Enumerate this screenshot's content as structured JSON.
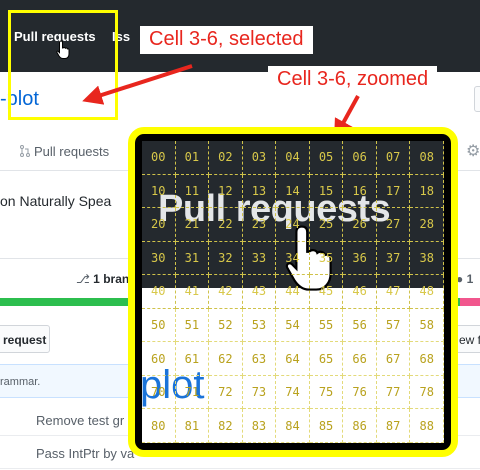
{
  "nav": {
    "pull_requests": "Pull requests",
    "issues": "Issues"
  },
  "repo": {
    "title": "-plot"
  },
  "tabs": {
    "pull_requests": "Pull requests"
  },
  "description": "on Naturally Spea",
  "stats": {
    "branches_count": "1",
    "branches_label": "bran",
    "contributors_count": "1"
  },
  "buttons": {
    "request": "request",
    "new_file": "ew f"
  },
  "commit": {
    "message": "rammar."
  },
  "files": [
    {
      "message": "Remove test gr"
    },
    {
      "message": "Pass IntPtr by va"
    }
  ],
  "annotations": {
    "selected_label": "Cell 3-6, selected",
    "zoomed_label": "Cell 3-6, zoomed"
  },
  "zoom": {
    "text": "Pull requests",
    "repo_text": "plot",
    "cells": [
      "00",
      "01",
      "02",
      "03",
      "04",
      "05",
      "06",
      "07",
      "08",
      "10",
      "11",
      "12",
      "13",
      "14",
      "15",
      "16",
      "17",
      "18",
      "20",
      "21",
      "22",
      "23",
      "24",
      "25",
      "26",
      "27",
      "28",
      "30",
      "31",
      "32",
      "33",
      "34",
      "35",
      "36",
      "37",
      "38",
      "40",
      "41",
      "42",
      "43",
      "44",
      "45",
      "46",
      "47",
      "48",
      "50",
      "51",
      "52",
      "53",
      "54",
      "55",
      "56",
      "57",
      "58",
      "60",
      "61",
      "62",
      "63",
      "64",
      "65",
      "66",
      "67",
      "68",
      "70",
      "71",
      "72",
      "73",
      "74",
      "75",
      "76",
      "77",
      "78",
      "80",
      "81",
      "82",
      "83",
      "84",
      "85",
      "86",
      "87",
      "88"
    ]
  },
  "colors": {
    "header_bg": "#24292e",
    "annotation_yellow": "#ffff00",
    "annotation_red": "#e8261e",
    "link_blue": "#0366d6",
    "lang_green": "#2cbe4e",
    "lang_pink": "#f1568d"
  },
  "icons": [
    "hand-cursor-icon",
    "pull-request-icon",
    "gear-icon",
    "branch-icon",
    "person-icon"
  ]
}
